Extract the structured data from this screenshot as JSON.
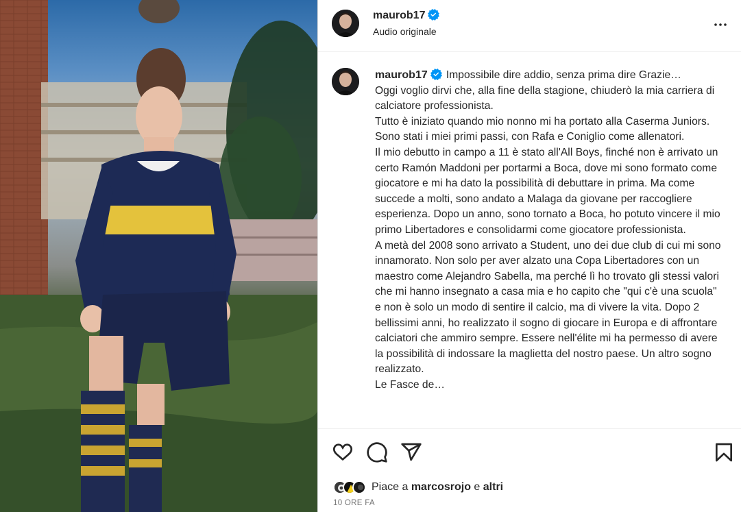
{
  "post": {
    "image_alt": "young boy in a Boca Juniors kit standing on grass",
    "author": {
      "username": "maurob17",
      "audio_label": "Audio originale",
      "verified": true
    },
    "caption_username": "maurob17",
    "caption_text": "Impossibile dire addio, senza prima dire Grazie…\nOggi voglio dirvi che, alla fine della stagione, chiuderò la mia carriera di calciatore professionista.\nTutto è iniziato quando mio nonno mi ha portato alla Caserma Juniors. Sono stati i miei primi passi, con Rafa e Coniglio come allenatori.\nIl mio debutto in campo a 11 è stato all'All Boys, finché non è arrivato un certo Ramón Maddoni per portarmi a Boca, dove mi sono formato come giocatore e mi ha dato la possibilità di debuttare in prima. Ma come succede a molti, sono andato a Malaga da giovane per raccogliere esperienza. Dopo un anno, sono tornato a Boca, ho potuto vincere il mio primo Libertadores e consolidarmi come giocatore professionista.\nA metà del 2008 sono arrivato a Student, uno dei due club di cui mi sono innamorato. Non solo per aver alzato una Copa Libertadores con un maestro come Alejandro Sabella, ma perché lì ho trovato gli stessi valori che mi hanno insegnato a casa mia e ho capito che \"qui c'è una scuola\" e non è solo un modo di sentire il calcio, ma di vivere la vita. Dopo 2 bellissimi anni, ho realizzato il sogno di giocare in Europa e di affrontare calciatori che ammiro sempre. Essere nell'élite mi ha permesso di avere la possibilità di indossare la maglietta del nostro paese. Un altro sogno realizzato.\nLe Fasce de…",
    "likes": {
      "prefix": "Piace a",
      "user": "marcosrojo",
      "conjunction": "e",
      "others": "altri"
    },
    "timestamp": "10 ORE FA"
  },
  "icons": {
    "more": "more-options-icon",
    "like": "heart-icon",
    "comment": "comment-icon",
    "share": "share-icon",
    "save": "bookmark-icon",
    "verified": "verified-badge-icon"
  },
  "colors": {
    "verified": "#0095f6",
    "text": "#262626",
    "secondary": "#737373",
    "border": "#dbdbdb"
  }
}
